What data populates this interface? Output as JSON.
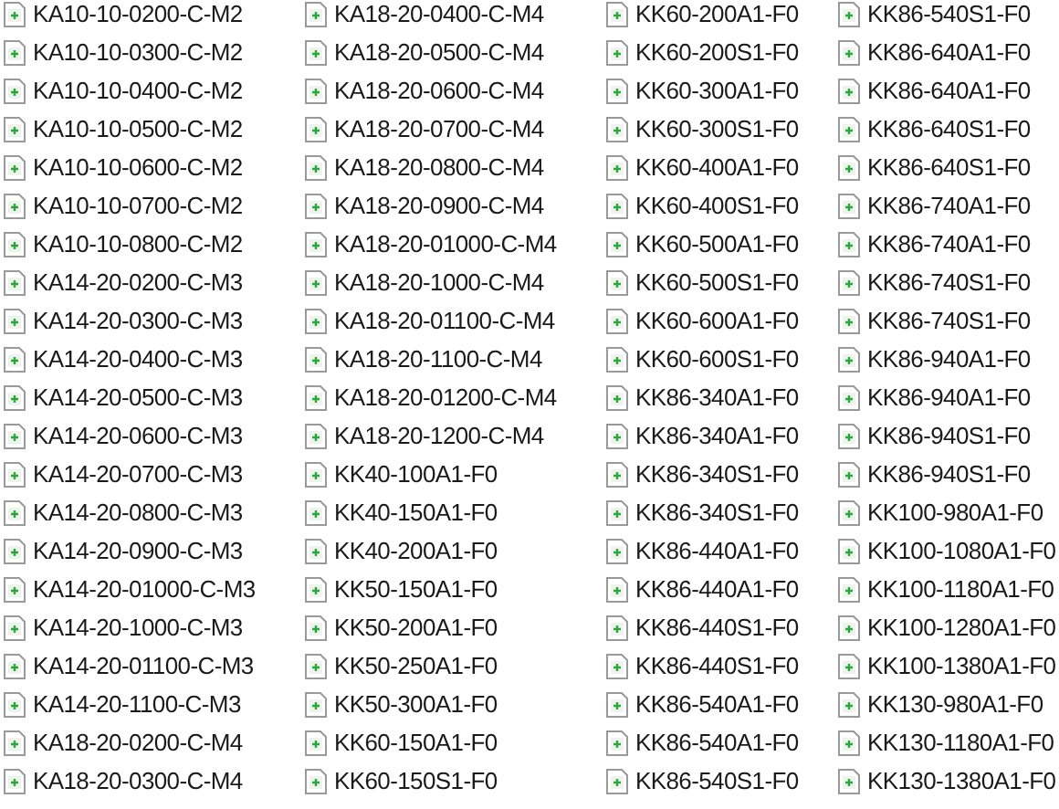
{
  "file_columns": [
    [
      "KA10-10-0200-C-M2",
      "KA10-10-0300-C-M2",
      "KA10-10-0400-C-M2",
      "KA10-10-0500-C-M2",
      "KA10-10-0600-C-M2",
      "KA10-10-0700-C-M2",
      "KA10-10-0800-C-M2",
      "KA14-20-0200-C-M3",
      "KA14-20-0300-C-M3",
      "KA14-20-0400-C-M3",
      "KA14-20-0500-C-M3",
      "KA14-20-0600-C-M3",
      "KA14-20-0700-C-M3",
      "KA14-20-0800-C-M3",
      "KA14-20-0900-C-M3",
      "KA14-20-01000-C-M3",
      "KA14-20-1000-C-M3",
      "KA14-20-01100-C-M3",
      "KA14-20-1100-C-M3",
      "KA18-20-0200-C-M4",
      "KA18-20-0300-C-M4"
    ],
    [
      "KA18-20-0400-C-M4",
      "KA18-20-0500-C-M4",
      "KA18-20-0600-C-M4",
      "KA18-20-0700-C-M4",
      "KA18-20-0800-C-M4",
      "KA18-20-0900-C-M4",
      "KA18-20-01000-C-M4",
      "KA18-20-1000-C-M4",
      "KA18-20-01100-C-M4",
      "KA18-20-1100-C-M4",
      "KA18-20-01200-C-M4",
      "KA18-20-1200-C-M4",
      "KK40-100A1-F0",
      "KK40-150A1-F0",
      "KK40-200A1-F0",
      "KK50-150A1-F0",
      "KK50-200A1-F0",
      "KK50-250A1-F0",
      "KK50-300A1-F0",
      "KK60-150A1-F0",
      "KK60-150S1-F0"
    ],
    [
      "KK60-200A1-F0",
      "KK60-200S1-F0",
      "KK60-300A1-F0",
      "KK60-300S1-F0",
      "KK60-400A1-F0",
      "KK60-400S1-F0",
      "KK60-500A1-F0",
      "KK60-500S1-F0",
      "KK60-600A1-F0",
      "KK60-600S1-F0",
      "KK86-340A1-F0",
      "KK86-340A1-F0",
      "KK86-340S1-F0",
      "KK86-340S1-F0",
      "KK86-440A1-F0",
      "KK86-440A1-F0",
      "KK86-440S1-F0",
      "KK86-440S1-F0",
      "KK86-540A1-F0",
      "KK86-540A1-F0",
      "KK86-540S1-F0"
    ],
    [
      "KK86-540S1-F0",
      "KK86-640A1-F0",
      "KK86-640A1-F0",
      "KK86-640S1-F0",
      "KK86-640S1-F0",
      "KK86-740A1-F0",
      "KK86-740A1-F0",
      "KK86-740S1-F0",
      "KK86-740S1-F0",
      "KK86-940A1-F0",
      "KK86-940A1-F0",
      "KK86-940S1-F0",
      "KK86-940S1-F0",
      "KK100-980A1-F0",
      "KK100-1080A1-F0",
      "KK100-1180A1-F0",
      "KK100-1280A1-F0",
      "KK100-1380A1-F0",
      "KK130-980A1-F0",
      "KK130-1180A1-F0",
      "KK130-1380A1-F0"
    ]
  ]
}
